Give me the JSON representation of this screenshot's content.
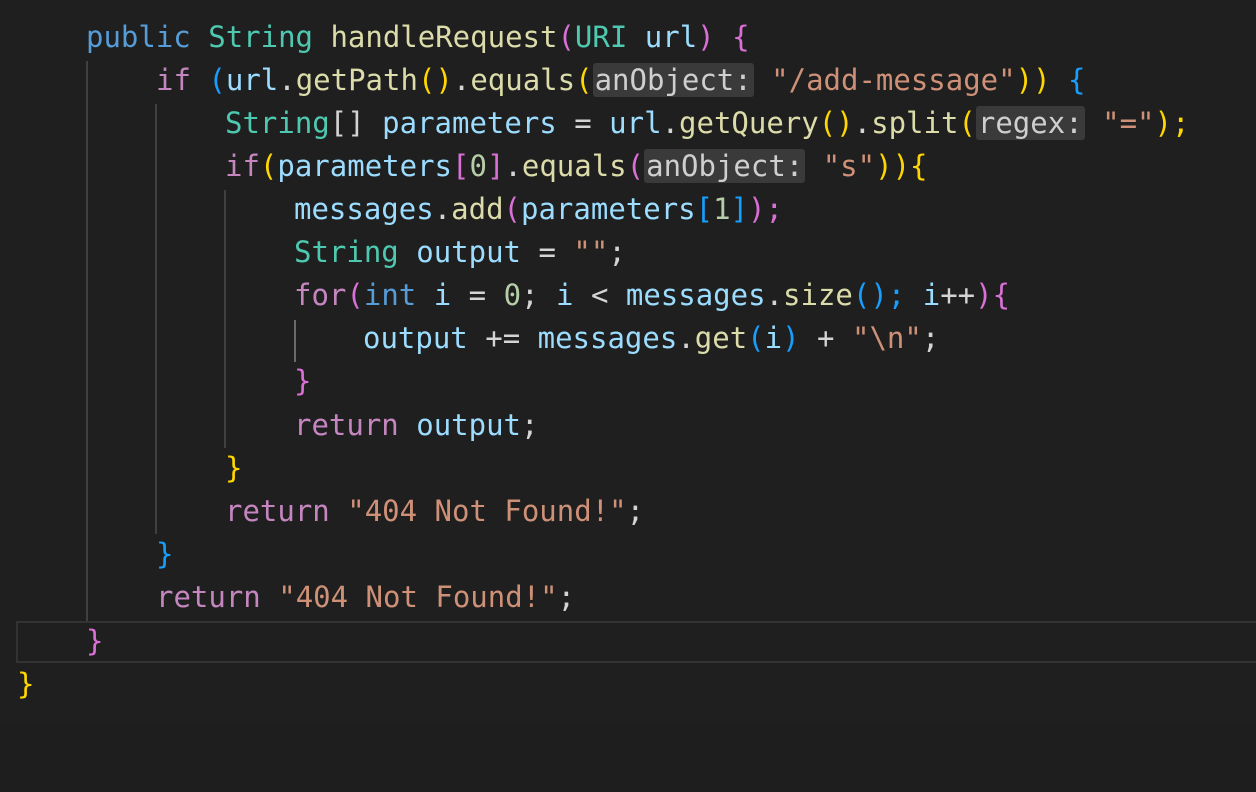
{
  "editor": {
    "language": "java",
    "theme_colors": {
      "background": "#1f1f1f",
      "keyword": "#569cd6",
      "control": "#c586c0",
      "type": "#4ec9b0",
      "function": "#dcdcaa",
      "variable": "#9cdcfe",
      "string": "#ce9178",
      "number": "#b5cea8",
      "bracket_gold": "#ffd700",
      "bracket_purple": "#da70d6",
      "bracket_blue": "#179fff",
      "inlay_hint_bg": "#3a3a3a"
    },
    "inlay_hints": {
      "anObject": "anObject:",
      "regex": "regex:"
    },
    "lines": [
      {
        "t": [
          "public",
          "String",
          "handleRequest",
          "(",
          "URI",
          "url",
          ")",
          "{"
        ]
      },
      {
        "t": [
          "if",
          "(",
          "url",
          ".",
          "getPath",
          "()",
          ".",
          "equals",
          "(",
          "\"/add-message\"",
          "))",
          "{"
        ]
      },
      {
        "t": [
          "String",
          "[]",
          "parameters",
          "=",
          "url",
          ".",
          "getQuery",
          "()",
          ".",
          "split",
          "(",
          "\"=\"",
          ");"
        ]
      },
      {
        "t": [
          "if",
          "(",
          "parameters",
          "[",
          "0",
          "]",
          ".",
          "equals",
          "(",
          "\"s\"",
          "))",
          "{"
        ]
      },
      {
        "t": [
          "messages",
          ".",
          "add",
          "(",
          "parameters",
          "[",
          "1",
          "]",
          ");"
        ]
      },
      {
        "t": [
          "String",
          "output",
          "=",
          "\"\"",
          ";"
        ]
      },
      {
        "t": [
          "for",
          "(",
          "int",
          "i",
          "=",
          "0",
          ";",
          "i",
          "<",
          "messages",
          ".",
          "size",
          "();",
          "i",
          "++",
          "){"
        ]
      },
      {
        "t": [
          "output",
          "+=",
          "messages",
          ".",
          "get",
          "(",
          "i",
          ")",
          "+",
          "\"\\n\"",
          ";"
        ]
      },
      {
        "t": [
          "}"
        ]
      },
      {
        "t": [
          "return",
          "output",
          ";"
        ]
      },
      {
        "t": [
          "}"
        ]
      },
      {
        "t": [
          "return",
          "\"404 Not Found!\"",
          ";"
        ]
      },
      {
        "t": [
          "}"
        ]
      },
      {
        "t": [
          "return",
          "\"404 Not Found!\"",
          ";"
        ]
      },
      {
        "t": [
          "}"
        ]
      },
      {
        "t": [
          "}"
        ]
      }
    ]
  }
}
